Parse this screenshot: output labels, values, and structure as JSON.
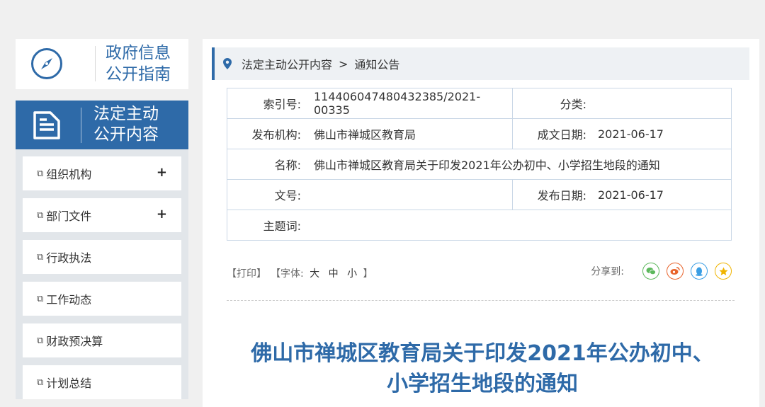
{
  "sidebar": {
    "guide_title": "政府信息公开指南",
    "active_title": "法定主动公开内容",
    "items": [
      {
        "label": "组织机构",
        "expand": "+"
      },
      {
        "label": "部门文件",
        "expand": "+"
      },
      {
        "label": "行政执法",
        "expand": ""
      },
      {
        "label": "工作动态",
        "expand": ""
      },
      {
        "label": "财政预决算",
        "expand": ""
      },
      {
        "label": "计划总结",
        "expand": ""
      }
    ]
  },
  "breadcrumb": {
    "items": [
      "法定主动公开内容",
      "通知公告"
    ],
    "separator": ">"
  },
  "meta": {
    "index_label": "索引号:",
    "index_value": "114406047480432385/2021-00335",
    "category_label": "分类:",
    "category_value": "",
    "publisher_label": "发布机构:",
    "publisher_value": "佛山市禅城区教育局",
    "created_label": "成文日期:",
    "created_value": "2021-06-17",
    "name_label": "名称:",
    "name_value": "佛山市禅城区教育局关于印发2021年公办初中、小学招生地段的通知",
    "docno_label": "文号:",
    "docno_value": "",
    "published_label": "发布日期:",
    "published_value": "2021-06-17",
    "keywords_label": "主题词:",
    "keywords_value": ""
  },
  "tools": {
    "print": "【打印】",
    "font_prefix": "【字体:",
    "font_large": "大",
    "font_medium": "中",
    "font_small": "小",
    "font_suffix": "】",
    "share_label": "分享到:"
  },
  "share_icons": [
    {
      "name": "wechat-icon",
      "color": "#5cb85c",
      "glyph": "●"
    },
    {
      "name": "weibo-icon",
      "color": "#e8632b",
      "glyph": "◉"
    },
    {
      "name": "qq-icon",
      "color": "#3a9ee4",
      "glyph": "▲"
    },
    {
      "name": "qzone-icon",
      "color": "#f0b400",
      "glyph": "★"
    }
  ],
  "document": {
    "title_line1": "佛山市禅城区教育局关于印发2021年公办初中、",
    "title_line2": "小学招生地段的通知"
  }
}
